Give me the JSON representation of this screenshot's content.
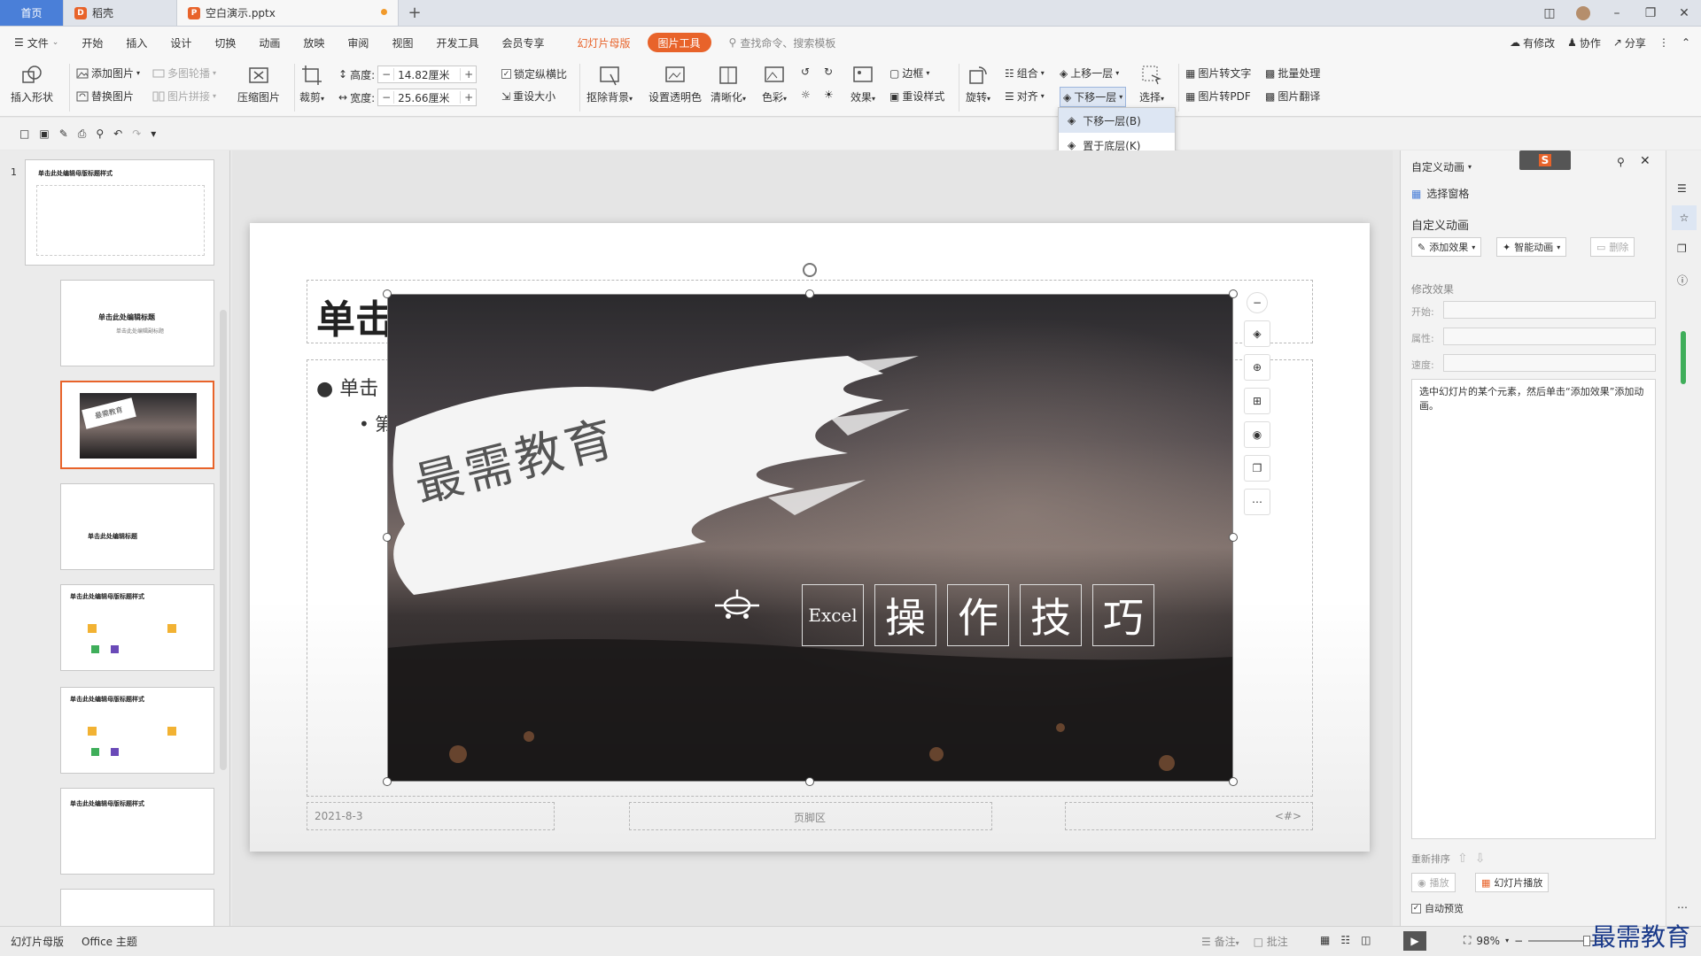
{
  "tabs": {
    "home": "首页",
    "docer": "稻壳",
    "doc": "空白演示.pptx"
  },
  "menu": {
    "file": "文件",
    "items": [
      "开始",
      "插入",
      "设计",
      "切换",
      "动画",
      "放映",
      "审阅",
      "视图",
      "开发工具",
      "会员专享"
    ],
    "slide_master": "幻灯片母版",
    "picture_tools": "图片工具",
    "search": "查找命令、搜索模板",
    "right": [
      "有修改",
      "协作",
      "分享"
    ]
  },
  "ribbon": {
    "insert_shape": "插入形状",
    "add_picture": "添加图片",
    "replace_picture": "替换图片",
    "multi_carousel": "多图轮播",
    "picture_splice": "图片拼接",
    "compress": "压缩图片",
    "crop": "裁剪",
    "height_label": "高度:",
    "height_value": "14.82厘米",
    "width_label": "宽度:",
    "width_value": "25.66厘米",
    "lock_ratio": "锁定纵横比",
    "reset_size": "重设大小",
    "remove_bg": "抠除背景",
    "set_transparent": "设置透明色",
    "sharpen": "清晰化",
    "color": "色彩",
    "effect": "效果",
    "border": "边框",
    "reset_style": "重设样式",
    "rotate": "旋转",
    "group": "组合",
    "align": "对齐",
    "bring_forward": "上移一层",
    "send_backward": "下移一层",
    "select": "选择",
    "pic_to_text": "图片转文字",
    "batch": "批量处理",
    "pic_to_pdf": "图片转PDF",
    "pic_translate": "图片翻译"
  },
  "dropdown": {
    "items": [
      "下移一层(B)",
      "置于底层(K)"
    ]
  },
  "slide": {
    "title_visible": "单击",
    "bullet_visible": "单击",
    "bullet2_visible": "第",
    "date": "2021-8-3",
    "footer": "页脚区",
    "page_num": "<#>",
    "image_brush_text": "最需教育",
    "image_excel": "Excel",
    "image_chars": [
      "操",
      "作",
      "技",
      "巧"
    ]
  },
  "thumbs": {
    "t1": "单击此处编辑母版标题样式",
    "t2": "单击此处编辑标题",
    "t2_sub": "单击此处编辑副标题",
    "t4": "单击此处编辑标题",
    "t5": "单击此处编辑母版标题样式",
    "t6": "单击此处编辑母版标题样式",
    "t7": "单击此处编辑母版标题样式",
    "slide1_num": "1"
  },
  "rpane": {
    "title": "自定义动画",
    "select_pane": "选择窗格",
    "section": "自定义动画",
    "add_effect": "添加效果",
    "smart_anim": "智能动画",
    "delete": "删除",
    "modify_effect": "修改效果",
    "start": "开始:",
    "property": "属性:",
    "speed": "速度:",
    "hint": "选中幻灯片的某个元素，然后单击“添加效果”添加动画。",
    "reorder": "重新排序",
    "play": "播放",
    "slideshow": "幻灯片播放",
    "auto_preview": "自动预览"
  },
  "status": {
    "mode": "幻灯片母版",
    "theme": "Office 主题",
    "notes": "备注",
    "comments": "批注",
    "zoom": "98%",
    "watermark": "最需教育"
  },
  "colors": {
    "accent": "#e8632a",
    "home_tab": "#4a7fd8"
  }
}
